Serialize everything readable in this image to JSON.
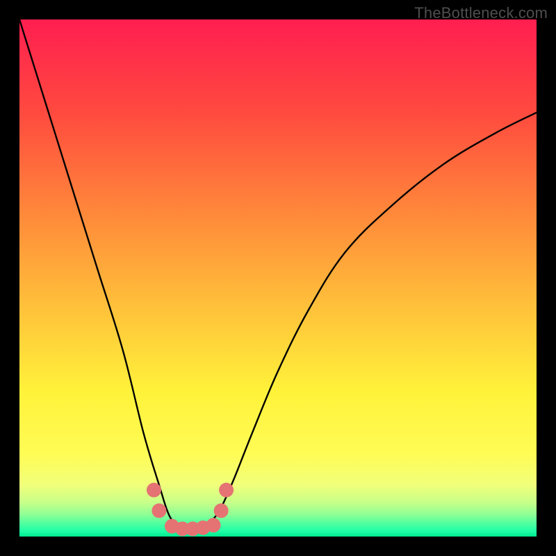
{
  "watermark": "TheBottleneck.com",
  "chart_data": {
    "type": "line",
    "title": "",
    "xlabel": "",
    "ylabel": "",
    "xlim": [
      0,
      100
    ],
    "ylim": [
      0,
      100
    ],
    "grid": false,
    "legend": false,
    "annotations": [],
    "series": [
      {
        "name": "bottleneck-curve",
        "x": [
          0,
          5,
          10,
          15,
          20,
          24,
          27,
          29,
          31,
          33,
          35,
          38,
          41,
          45,
          50,
          56,
          63,
          72,
          82,
          92,
          100
        ],
        "y": [
          100,
          84,
          68,
          52,
          36,
          20,
          10,
          4,
          2,
          1.5,
          2,
          4,
          10,
          20,
          32,
          44,
          55,
          64,
          72,
          78,
          82
        ]
      }
    ],
    "markers": [
      {
        "name": "left-upper-dot",
        "x": 26,
        "y": 9
      },
      {
        "name": "left-lower-dot",
        "x": 27,
        "y": 5
      },
      {
        "name": "right-upper-dot",
        "x": 40,
        "y": 9
      },
      {
        "name": "right-lower-dot",
        "x": 39,
        "y": 5
      },
      {
        "name": "bottom-dot-1",
        "x": 29.5,
        "y": 2
      },
      {
        "name": "bottom-dot-2",
        "x": 31.5,
        "y": 1.5
      },
      {
        "name": "bottom-dot-3",
        "x": 33.5,
        "y": 1.5
      },
      {
        "name": "bottom-dot-4",
        "x": 35.5,
        "y": 1.7
      },
      {
        "name": "bottom-dot-5",
        "x": 37.5,
        "y": 2.2
      }
    ],
    "note": "Axis values are estimated on a 0–100 normalized scale from pixel positions; the original chart has no visible axis ticks or labels."
  },
  "colors": {
    "gradient_stops": [
      {
        "offset": 0.0,
        "color": "#ff1e50"
      },
      {
        "offset": 0.18,
        "color": "#ff4a3f"
      },
      {
        "offset": 0.38,
        "color": "#ff8a3a"
      },
      {
        "offset": 0.56,
        "color": "#ffc23a"
      },
      {
        "offset": 0.72,
        "color": "#fff23a"
      },
      {
        "offset": 0.84,
        "color": "#fffc55"
      },
      {
        "offset": 0.9,
        "color": "#f1ff7a"
      },
      {
        "offset": 0.935,
        "color": "#c6ff8a"
      },
      {
        "offset": 0.958,
        "color": "#8cff95"
      },
      {
        "offset": 0.975,
        "color": "#4fffa0"
      },
      {
        "offset": 0.99,
        "color": "#1effa6"
      },
      {
        "offset": 1.0,
        "color": "#00e88f"
      }
    ],
    "curve": "#000000",
    "marker": "#e57373",
    "frame": "#000000"
  }
}
